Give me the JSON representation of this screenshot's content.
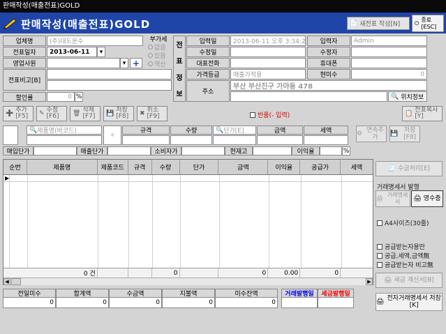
{
  "window_title": "판매작성(매출전표)GOLD",
  "header": {
    "title": "판매작성(매출전표)GOLD",
    "new_btn": "새전표 작성[N]",
    "close_btn": "종료[ESC]"
  },
  "form": {
    "company_label": "업체명",
    "company_value": "(주)대도운수",
    "date_label": "전표일자",
    "date_value": "2013-06-11",
    "sales_label": "영업사원",
    "memo_label": "전표비고[B]",
    "discount_label": "할인률",
    "discount_value": "0",
    "vat_label": "부가세",
    "vat_options": [
      "없음",
      "있음",
      "역산"
    ],
    "side_label": [
      "전",
      "표",
      "정",
      "보"
    ],
    "reg_label": "입력일",
    "reg_value": "2013-06-11 오후 3:34:2",
    "edit_label": "수정일",
    "rep_label": "대표전화",
    "price_label": "가격등급",
    "price_value": "매출가적용",
    "addr_label": "주소",
    "addr_value": "부산 부산진구 가야동 478",
    "inputter_label": "입력자",
    "inputter_value": "Admin",
    "editor_label": "수정자",
    "mobile_label": "휴대폰",
    "unpaid_label": "현미수",
    "unpaid_value": "0",
    "locate_btn": "위치정보"
  },
  "toolbar": {
    "add": "추가[F5]",
    "edit": "수정[F6]",
    "del": "삭제[F7]",
    "save": "저장[F8]",
    "cancel": "취소[F9]",
    "return_chk": "반품(- 입력)",
    "copy": "전표복사[Y]"
  },
  "entry": {
    "product_ph": "제품명(바코드)",
    "spec": "규격",
    "qty": "수량",
    "price_ph": "단가[E]",
    "amount": "금액",
    "tax": "세액",
    "cont_btn": "연속추가",
    "save_btn": "저장[F8]",
    "buy_price": "매입단가",
    "sell_price": "매출단가",
    "consumer_price": "소비자가",
    "stock": "현재고",
    "margin": "이익율"
  },
  "grid": {
    "columns": [
      "순번",
      "제품명",
      "제품코드",
      "규격",
      "수량",
      "단가",
      "금액",
      "이익율",
      "공급가",
      "세액"
    ],
    "totals": {
      "count": "0 건",
      "qty": "0",
      "amount": "0",
      "margin": "0.00",
      "supply": "0"
    }
  },
  "right": {
    "receipt": "수금처리[E]",
    "group": "거래명세서 발행",
    "tx_btn": "거래명세서",
    "receipt_btn": "영수증",
    "a4": "A4사이즈(30줄)",
    "opt1": "공급받는자용만",
    "opt2": "공급,세액,금액無",
    "opt3": "공급받는자 비고無",
    "tax_invoice": "세금 계산서[B]",
    "etx": "전자거래명세서 저장[K]"
  },
  "footer": {
    "items": [
      {
        "label": "전일미수",
        "value": "0"
      },
      {
        "label": "합계액",
        "value": "0"
      },
      {
        "label": "수금액",
        "value": "0"
      },
      {
        "label": "지불액",
        "value": "0"
      },
      {
        "label": "미수잔액",
        "value": "0"
      }
    ],
    "tx_issued": "거래발행일",
    "tax_issued": "세금발행일"
  },
  "colors": {
    "header": "#1f45a8",
    "tx_issued": "#0000ee",
    "tax_issued": "#ee0000"
  }
}
